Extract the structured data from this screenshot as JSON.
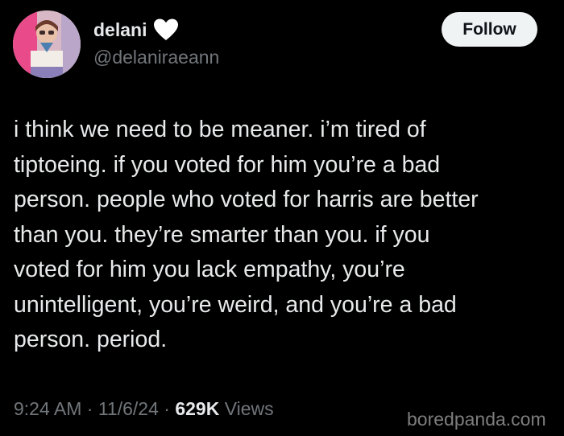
{
  "author": {
    "display_name": "delani",
    "name_emoji": "white-heart-icon",
    "handle": "@delaniraeann",
    "avatar": "profile-photo"
  },
  "follow_button": {
    "label": "Follow"
  },
  "tweet": {
    "text_lines": [
      "i think we need to be meaner. i’m tired of",
      "tiptoeing. if you voted for him you’re a bad",
      "person. people who voted for harris are better",
      "than you. they’re smarter than you. if you",
      "voted for him you lack empathy, you’re",
      "unintelligent, you’re weird, and you’re a bad",
      "person. period."
    ]
  },
  "meta": {
    "time": "9:24 AM",
    "separator": "·",
    "date": "11/6/24",
    "views_count": "629K",
    "views_label": "Views"
  },
  "watermark": "boredpanda.com",
  "colors": {
    "background": "#000000",
    "primary_text": "#e7e9ea",
    "secondary_text": "#71767b",
    "follow_bg": "#eff3f4",
    "follow_text": "#0f1419"
  }
}
